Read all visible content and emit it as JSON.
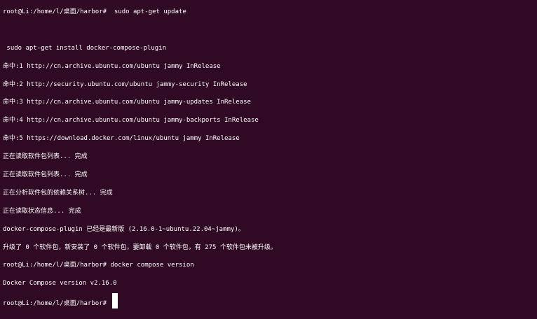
{
  "terminal": {
    "lines": [
      "root@Li:/home/l/桌面/harbor#  sudo apt-get update",
      "",
      " sudo apt-get install docker-compose-plugin",
      "命中:1 http://cn.archive.ubuntu.com/ubuntu jammy InRelease",
      "命中:2 http://security.ubuntu.com/ubuntu jammy-security InRelease",
      "命中:3 http://cn.archive.ubuntu.com/ubuntu jammy-updates InRelease",
      "命中:4 http://cn.archive.ubuntu.com/ubuntu jammy-backports InRelease",
      "命中:5 https://download.docker.com/linux/ubuntu jammy InRelease",
      "正在读取软件包列表... 完成",
      "正在读取软件包列表... 完成",
      "正在分析软件包的依赖关系树... 完成",
      "正在读取状态信息... 完成",
      "docker-compose-plugin 已经是最新版 (2.16.0-1~ubuntu.22.04~jammy)。",
      "升级了 0 个软件包，新安装了 0 个软件包，要卸载 0 个软件包，有 275 个软件包未被升级。",
      "root@Li:/home/l/桌面/harbor# docker compose version",
      "Docker Compose version v2.16.0"
    ],
    "prompt": "root@Li:/home/l/桌面/harbor#"
  },
  "colors": {
    "background": "#300a24",
    "foreground": "#ffffff"
  }
}
